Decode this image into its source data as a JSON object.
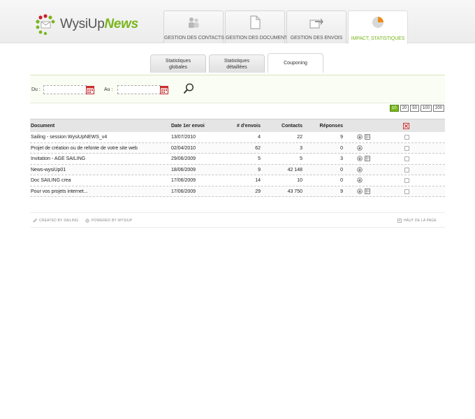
{
  "logo": {
    "word1": "WysiUp",
    "word2": "News"
  },
  "nav": [
    {
      "label": "Gestion des contacts",
      "icon": "contacts-icon",
      "active": false
    },
    {
      "label": "Gestion des documents",
      "icon": "document-icon",
      "active": false
    },
    {
      "label": "Gestion des envois",
      "icon": "send-icon",
      "active": false
    },
    {
      "label": "Impact, statistiques",
      "icon": "pie-chart-icon",
      "active": true
    }
  ],
  "subtabs": [
    {
      "line1": "Statistiques",
      "line2": "globales",
      "active": false
    },
    {
      "line1": "Statistiques",
      "line2": "détaillées",
      "active": false
    },
    {
      "line1": "Couponing",
      "line2": "",
      "active": true
    }
  ],
  "filter": {
    "from_label": "Du :",
    "to_label": "Au :",
    "from_value": "",
    "to_value": ""
  },
  "page_sizes": [
    "10",
    "20",
    "50",
    "100",
    "200"
  ],
  "page_size_active": "10",
  "table": {
    "headers": {
      "document": "Document",
      "date": "Date 1er envoi",
      "envois": "# d'envois",
      "contacts": "Contacts",
      "reponses": "Réponses"
    },
    "rows": [
      {
        "document": "Sailing - session WysiUpNEWS_v4",
        "date": "13/07/2010",
        "envois": "4",
        "contacts": "22",
        "reponses": "9",
        "icons": true
      },
      {
        "document": "Projet de création ou de refonte de votre site web",
        "date": "02/04/2010",
        "envois": "62",
        "contacts": "3",
        "reponses": "0",
        "icons": false
      },
      {
        "document": "Invitation - AGE SAILING",
        "date": "29/06/2009",
        "envois": "5",
        "contacts": "5",
        "reponses": "3",
        "icons": true
      },
      {
        "document": "News-wysiUp01",
        "date": "18/06/2009",
        "envois": "9",
        "contacts": "42 148",
        "reponses": "0",
        "icons": false
      },
      {
        "document": "Doc SAILING crea",
        "date": "17/06/2009",
        "envois": "14",
        "contacts": "10",
        "reponses": "0",
        "icons": false
      },
      {
        "document": "Pour vos projets internet...",
        "date": "17/06/2009",
        "envois": "29",
        "contacts": "43 750",
        "reponses": "9",
        "icons": true
      }
    ]
  },
  "footer": {
    "created": "Created by Sailing",
    "powered": "Powered by WysiUp",
    "top": "Haut de la page"
  },
  "colors": {
    "accent": "#7ab51d",
    "header_bg": "#ececec"
  }
}
